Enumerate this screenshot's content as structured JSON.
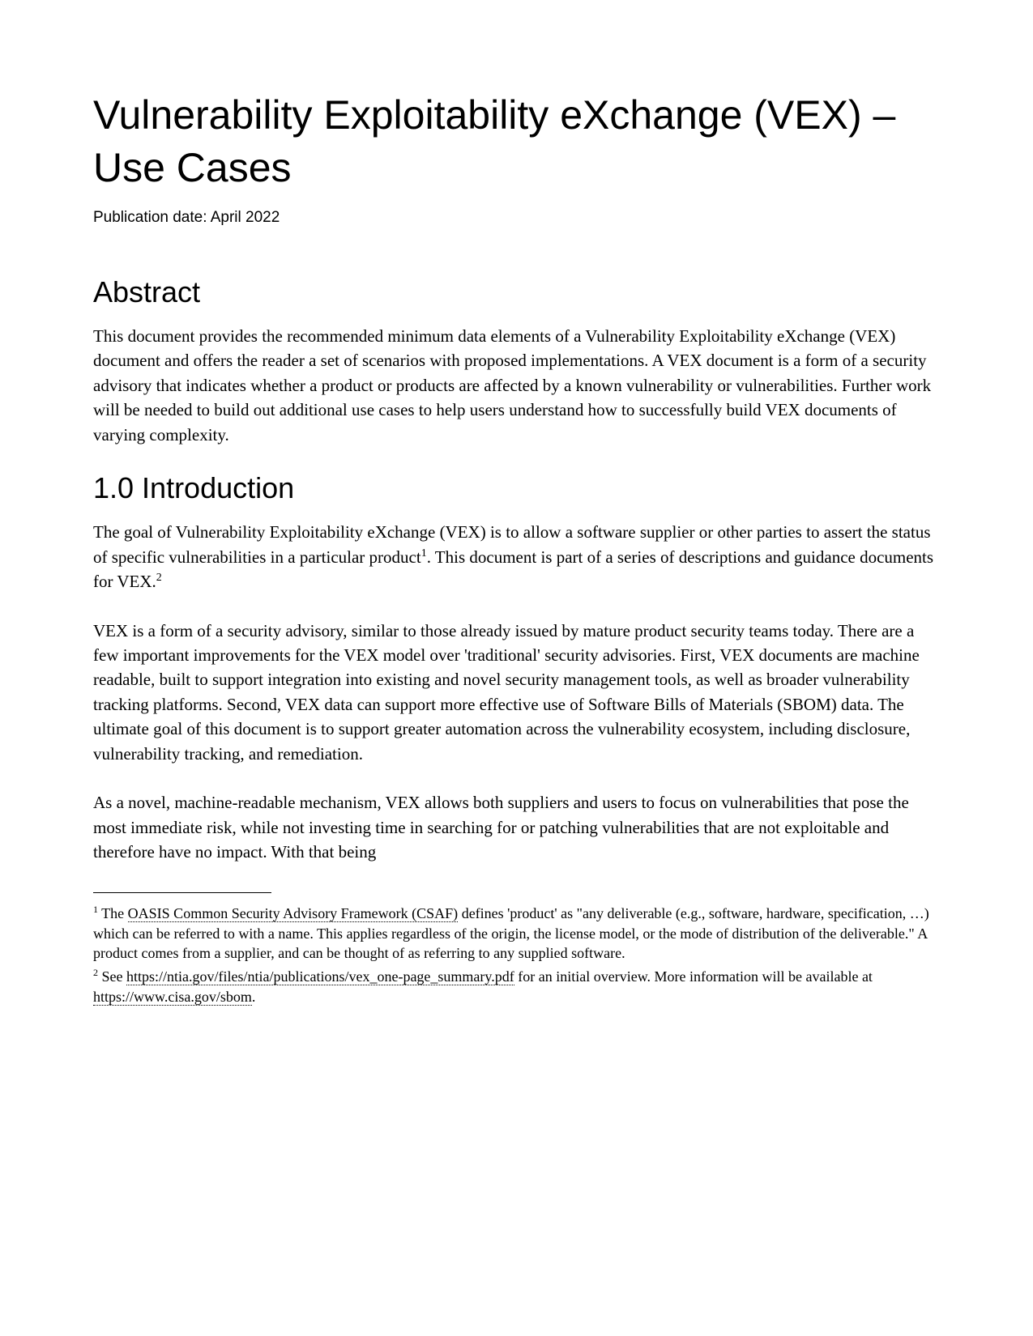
{
  "title": "Vulnerability Exploitability eXchange (VEX) – Use Cases",
  "pubdate": "Publication date: April 2022",
  "abstract": {
    "heading": "Abstract",
    "p1": "This document provides the recommended minimum data elements of a Vulnerability Exploitability eXchange (VEX) document and offers the reader a set of scenarios with proposed implementations. A VEX document is a form of a security advisory that indicates whether a product or products are affected by a known vulnerability or vulnerabilities. Further work will be needed to build out additional use cases to help users understand how to successfully build VEX documents of varying complexity."
  },
  "intro": {
    "heading": "1.0 Introduction",
    "p1a": "The goal of Vulnerability Exploitability eXchange (VEX) is to allow a software supplier or other parties to assert the status of specific vulnerabilities in a particular product",
    "p1b": ". This document is part of a series of descriptions and guidance documents for VEX.",
    "p2": "VEX is a form of a security advisory, similar to those already issued by mature product security teams today.  There are a few important improvements for the VEX model over 'traditional' security advisories. First, VEX documents are machine readable, built to support integration into existing and novel security management tools, as well as broader vulnerability tracking platforms. Second, VEX data can support more effective use of Software Bills of Materials (SBOM) data. The ultimate goal of this document is to support greater automation across the vulnerability ecosystem, including disclosure, vulnerability tracking, and remediation.",
    "p3": "As a novel, machine-readable mechanism, VEX allows both suppliers and users to focus on vulnerabilities that pose the most immediate risk, while not investing time in searching for or patching vulnerabilities that are not exploitable and therefore have no impact. With that being"
  },
  "footnotes": {
    "fn1": {
      "marker": "1",
      "pre": " The ",
      "link": "OASIS Common Security Advisory Framework (CSAF)",
      "post": " defines 'product' as \"any deliverable (e.g., software, hardware, specification, …) which can be referred to with a name. This applies regardless of the origin, the license model, or the mode of distribution of the deliverable.\" A product comes from a supplier, and can be thought of as referring to any supplied software."
    },
    "fn2": {
      "marker": "2",
      "pre": " See ",
      "link1": "https://ntia.gov/files/ntia/publications/vex_one-page_summary.pdf",
      "mid": " for an initial overview. More information will be available at ",
      "link2": "https://www.cisa.gov/sbom",
      "post": "."
    }
  }
}
